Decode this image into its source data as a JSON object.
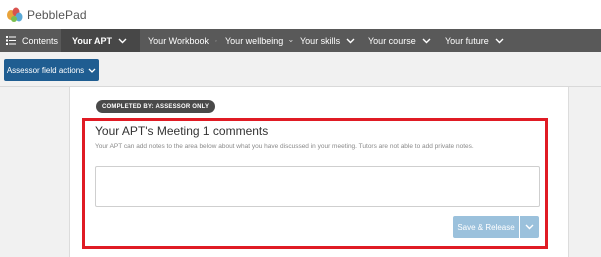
{
  "app": {
    "logo_text": "PebblePad"
  },
  "nav": {
    "items": [
      {
        "label": "Contents",
        "icon": "list-icon"
      },
      {
        "label": "Your APT",
        "active": true
      },
      {
        "label": "Your Workbook"
      },
      {
        "label": "Your wellbeing"
      },
      {
        "label": "Your skills"
      },
      {
        "label": "Your course"
      },
      {
        "label": "Your future"
      }
    ]
  },
  "toolbar": {
    "assessor_actions_label": "Assessor field actions"
  },
  "section": {
    "badge": "COMPLETED BY: ASSESSOR ONLY",
    "title": "Your APT's Meeting 1 comments",
    "description": "Your APT can add notes to the area below about what you have discussed in your meeting.  Tutors are not able to add private notes.",
    "notes_value": "",
    "save_label": "Save & Release"
  },
  "colors": {
    "nav_bg": "#595959",
    "nav_active_bg": "#474747",
    "primary_button": "#1f5d91",
    "save_button": "#9bc1dc",
    "highlight": "#e01b24",
    "badge_bg": "#4a4a4a"
  }
}
